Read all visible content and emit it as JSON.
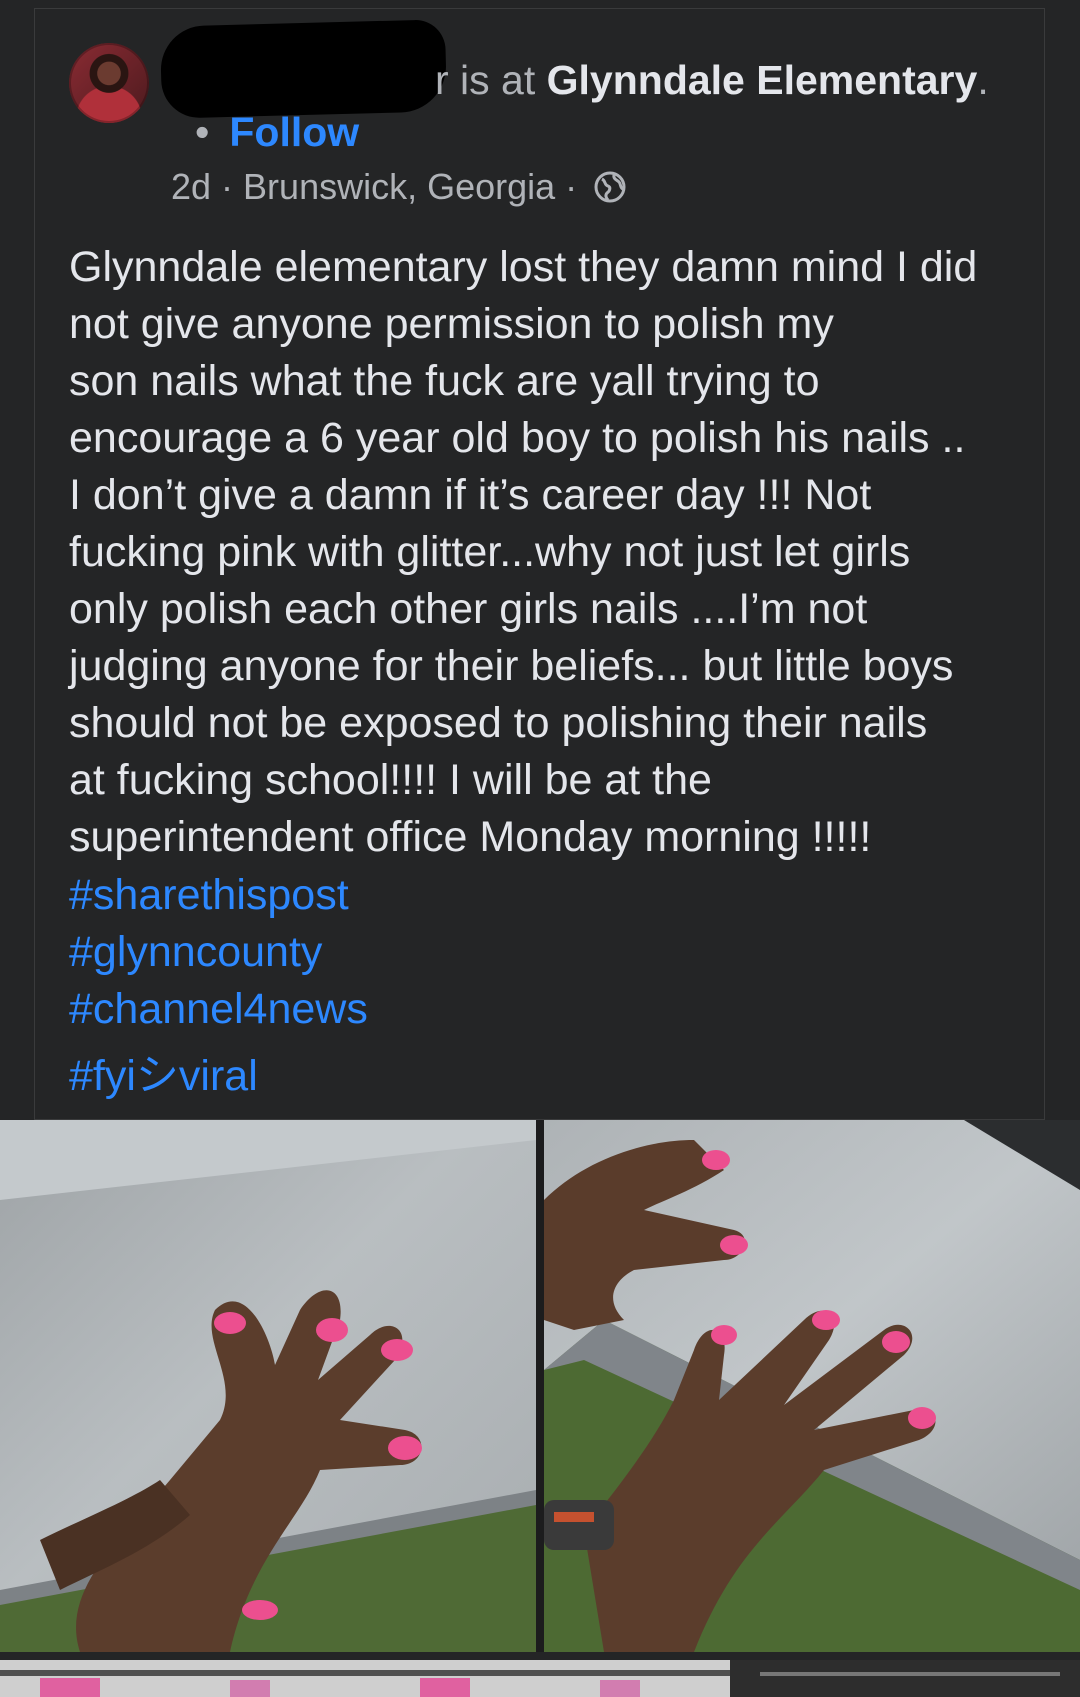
{
  "post": {
    "author_visible_suffix": "r",
    "checkin_text": " is at ",
    "place": "Glynndale Elementary",
    "place_suffix": ".",
    "follow_dot": "•",
    "follow_label": "Follow",
    "time": "2d",
    "meta_sep": "·",
    "location": "Brunswick, Georgia",
    "privacy_icon": "globe-icon",
    "body_lines": [
      "Glynndale elementary lost they damn mind I did",
      "not give anyone permission to polish my",
      "son nails what the fuck are yall trying to",
      "encourage a 6 year old boy to polish his nails ..",
      "I don’t give a damn if it’s career day !!! Not",
      "fucking pink with glitter...why not just let girls",
      "only polish each other girls nails ....I’m not",
      "judging anyone for their beliefs... but little boys",
      "should not be exposed to polishing their nails",
      "at fucking school!!!! I will be at the",
      "superintendent office Monday morning !!!!!"
    ],
    "hashtags": [
      "#sharethispost",
      "#glynncounty",
      "#channel4news",
      "#fyiシviral"
    ]
  },
  "colors": {
    "background": "#242526",
    "text": "#e4e6eb",
    "secondary_text": "#b0b3b8",
    "link": "#2d88ff",
    "nail_polish": "#ec4f8f"
  },
  "photos": [
    {
      "subject": "child-hand-pink-nails-1"
    },
    {
      "subject": "child-hand-pink-nails-2"
    }
  ]
}
